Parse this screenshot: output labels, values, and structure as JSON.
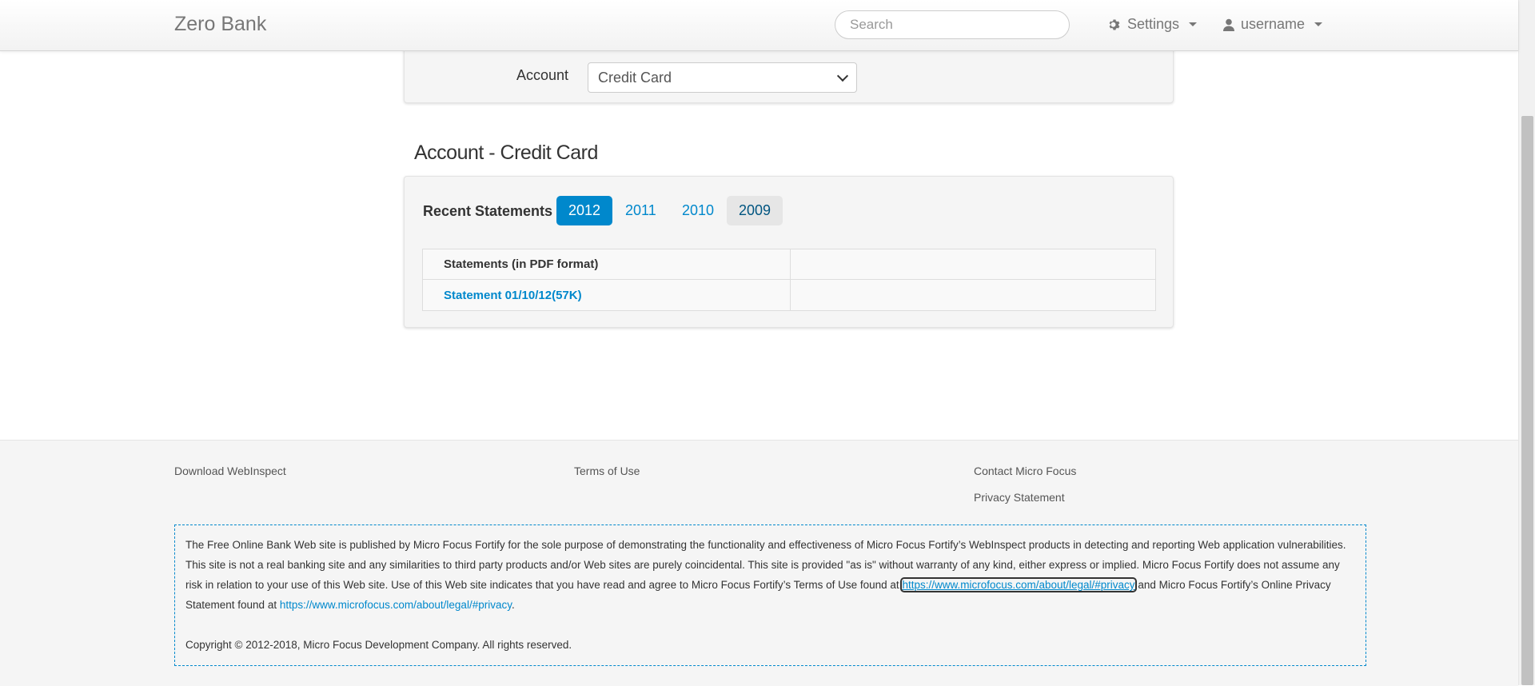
{
  "navbar": {
    "brand": "Zero Bank",
    "search_placeholder": "Search",
    "settings_label": "Settings",
    "username_label": "username"
  },
  "filter": {
    "account_label": "Account",
    "account_selected": "Credit Card"
  },
  "section": {
    "title": "Account - Credit Card"
  },
  "statements": {
    "recent_label": "Recent Statements",
    "years": [
      "2012",
      "2011",
      "2010",
      "2009"
    ],
    "active_year": "2012",
    "table_header": "Statements (in PDF format)",
    "rows": [
      {
        "link": "Statement 01/10/12(57K)"
      }
    ]
  },
  "footer": {
    "download": "Download WebInspect",
    "terms": "Terms of Use",
    "contact": "Contact Micro Focus",
    "privacy": "Privacy Statement",
    "disclaimer_part1": "The Free Online Bank Web site is published by Micro Focus Fortify for the sole purpose of demonstrating the functionality and effectiveness of Micro Focus Fortify’s WebInspect products in detecting and reporting Web application vulnerabilities. This site is not a real banking site and any similarities to third party products and/or Web sites are purely coincidental. This site is provided \"as is\" without warranty of any kind, either express or implied. Micro Focus Fortify does not assume any risk in relation to your use of this Web site. Use of this Web site indicates that you have read and agree to Micro Focus Fortify’s Terms of Use found at ",
    "terms_url": "https://www.microfocus.com/about/legal/#privacy",
    "disclaimer_part2": " and Micro Focus Fortify’s Online Privacy Statement found at ",
    "privacy_url": "https://www.microfocus.com/about/legal/#privacy",
    "disclaimer_part3": ".",
    "copyright": "Copyright © 2012-2018, Micro Focus Development Company. All rights reserved."
  },
  "colors": {
    "accent": "#0088cc",
    "footer_bg": "#f5f5f5"
  }
}
